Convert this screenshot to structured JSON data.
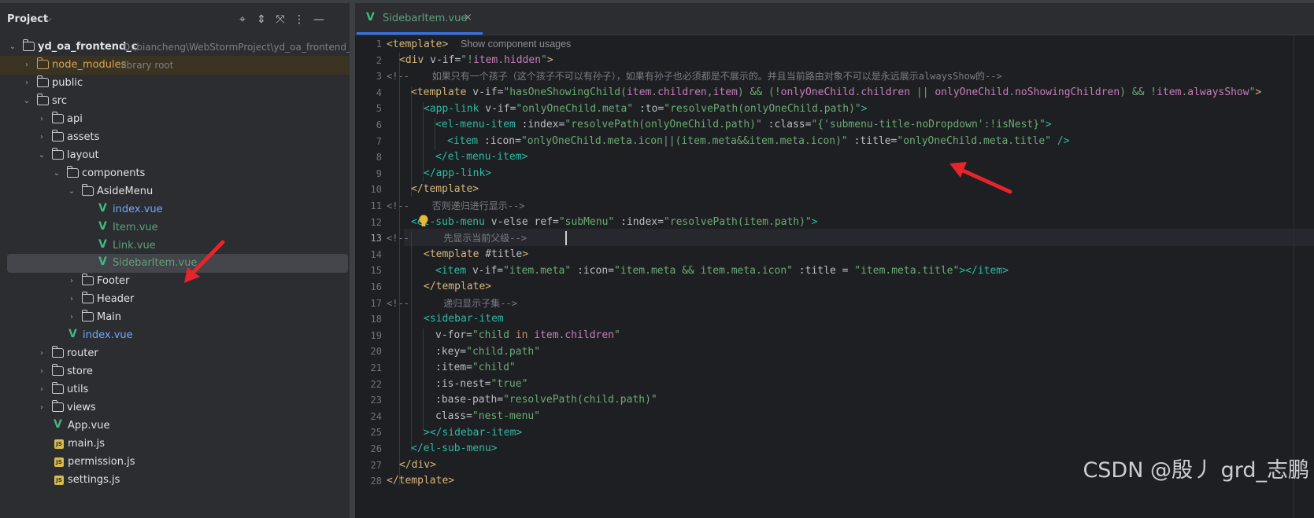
{
  "project": {
    "title": "Project",
    "header_icons": [
      "locate-icon",
      "expand-all-icon",
      "collapse-all-icon",
      "more-options-icon",
      "minimize-icon"
    ],
    "root": {
      "name": "yd_oa_frontend_c",
      "path": "D:\\biancheng\\WebStormProject\\yd_oa_frontend_c"
    },
    "node_modules": {
      "name": "node_modules",
      "hint": "library root"
    },
    "items": {
      "public": "public",
      "src": "src",
      "api": "api",
      "assets": "assets",
      "layout": "layout",
      "components": "components",
      "asidemenu": "AsideMenu",
      "index_vue_1": "index.vue",
      "item_vue": "Item.vue",
      "link_vue": "Link.vue",
      "sidebaritem_vue": "SidebarItem.vue",
      "footer": "Footer",
      "header": "Header",
      "main": "Main",
      "index_vue_2": "index.vue",
      "router": "router",
      "store": "store",
      "utils": "utils",
      "views": "views",
      "app_vue": "App.vue",
      "main_js": "main.js",
      "permission_js": "permission.js",
      "settings_js": "settings.js"
    }
  },
  "editor": {
    "tab": {
      "label": "SidebarItem.vue",
      "close": "×"
    },
    "current_line": 13,
    "line_numbers": [
      "1",
      "2",
      "3",
      "4",
      "5",
      "6",
      "7",
      "8",
      "9",
      "10",
      "11",
      "12",
      "13",
      "14",
      "15",
      "16",
      "17",
      "18",
      "19",
      "20",
      "21",
      "22",
      "23",
      "24",
      "25",
      "26",
      "27",
      "28"
    ],
    "code": {
      "l1": [
        "<template>",
        "Show component usages"
      ],
      "l2": [
        "<div ",
        "v-if=",
        "\"!",
        "item",
        ".",
        "hidden",
        "\"",
        ">"
      ],
      "l3": "<!--    如果只有一个孩子（这个孩子不可以有孙子），如果有孙子也必须都是不展示的。并且当前路由对象不可以是永远展示alwaysShow的-->",
      "l4": [
        "<template ",
        "v-if=",
        "\"hasOneShowingChild(",
        "item",
        ".",
        "children",
        ",",
        "item",
        ") && (!",
        "onlyOneChild",
        ".",
        "children",
        " || ",
        "onlyOneChild",
        ".",
        "noShowingChildren",
        ") && !",
        "item",
        ".",
        "alwaysShow",
        "\"",
        ">"
      ],
      "l5": [
        "<app-link ",
        "v-if=",
        "\"onlyOneChild.meta\"",
        " :to=",
        "\"resolvePath(onlyOneChild.path)\"",
        ">"
      ],
      "l6": [
        "<el-menu-item ",
        ":index=",
        "\"resolvePath(onlyOneChild.path)\"",
        " :class=",
        "\"{",
        "'submenu-title-noDropdown'",
        ":!isNest}\"",
        ">"
      ],
      "l7": [
        "<item ",
        ":icon=",
        "\"onlyOneChild.meta.icon||(item.meta&&item.meta.icon)\"",
        " :title=",
        "\"onlyOneChild.meta.title\"",
        " />"
      ],
      "l8": "</el-menu-item>",
      "l9": "</app-link>",
      "l10": "</template>",
      "l11": "<!--    否则递归进行显示-->",
      "l12": [
        "<el-sub-menu ",
        "v-else ",
        "ref=",
        "\"subMenu\"",
        " :index=",
        "\"resolvePath(item.path)\"",
        ">"
      ],
      "l13": "<!--      先显示当前父级-->",
      "l14": [
        "<template ",
        "#title",
        ">"
      ],
      "l15": [
        "<item ",
        "v-if=",
        "\"item.meta\"",
        " :icon=",
        "\"item.meta && item.meta.icon\"",
        " :title = ",
        "\"item.meta.title\"",
        "></item>"
      ],
      "l16": "</template>",
      "l17": "<!--      递归显示子集-->",
      "l18": "<sidebar-item",
      "l19": [
        "v-for=",
        "\"child ",
        "in ",
        "item",
        ".",
        "children",
        "\""
      ],
      "l20": [
        ":key=",
        "\"child.path\""
      ],
      "l21": [
        ":item=",
        "\"child\""
      ],
      "l22": [
        ":is-nest=",
        "\"true\""
      ],
      "l23": [
        ":base-path=",
        "\"resolvePath(child.path)\""
      ],
      "l24": [
        "class=",
        "\"nest-menu\""
      ],
      "l25": "></sidebar-item>",
      "l26": "</el-sub-menu>",
      "l27": "</div>",
      "l28": "</template>"
    }
  },
  "watermark": "CSDN @殷丿 grd_志鹏",
  "colors": {
    "accent": "#3574f0",
    "vue_green": "#41b883",
    "tag": "#d5b778",
    "string": "#6aab73",
    "comment": "#7a7e85",
    "annotation_red": "#e5252a"
  }
}
